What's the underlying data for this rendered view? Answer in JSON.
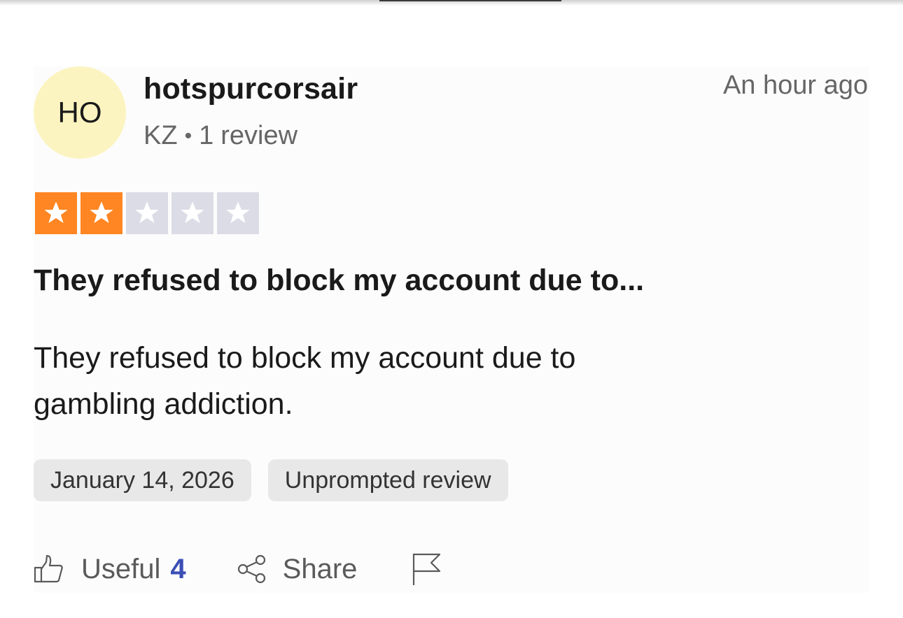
{
  "reviewer": {
    "initials": "HO",
    "name": "hotspurcorsair",
    "country": "KZ",
    "separator": "•",
    "review_count": "1",
    "review_label": "review"
  },
  "time_ago": "An hour ago",
  "rating": {
    "value": 2,
    "max": 5,
    "color_filled": "#ff8622",
    "color_empty": "#dcdce6"
  },
  "review": {
    "title": "They refused to block my account due to...",
    "body": "They refused to block my account due to gambling addiction."
  },
  "tags": {
    "date": "January 14, 2026",
    "type": "Unprompted review"
  },
  "actions": {
    "useful_label": "Useful",
    "useful_count": "4",
    "useful_icon": "thumbs-up-icon",
    "share_label": "Share",
    "share_icon": "share-icon",
    "report_icon": "flag-icon",
    "accent_color": "#3c4fb5"
  }
}
